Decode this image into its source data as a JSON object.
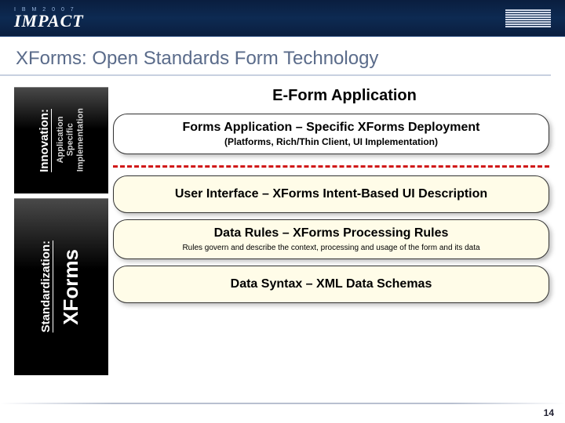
{
  "header": {
    "event_small": "I B M   2 0 0 7",
    "event_main": "IMPACT",
    "company": "IBM"
  },
  "title": "XForms:  Open Standards Form Technology",
  "left": {
    "innovation": "Innovation:",
    "app_specific": "Application\nSpecific\nImplementation",
    "standardization": "Standardization:",
    "xforms": "XForms"
  },
  "diagram": {
    "app_title": "E-Form Application",
    "layer1_title": "Forms Application – Specific XForms Deployment",
    "layer1_sub": "(Platforms, Rich/Thin Client, UI Implementation)",
    "layer2_title": "User Interface – XForms Intent-Based UI Description",
    "layer3_title": "Data Rules – XForms Processing Rules",
    "layer3_sub": "Rules govern and describe the context, processing and usage of the form and its data",
    "layer4_title": "Data Syntax – XML Data Schemas"
  },
  "page_number": "14"
}
